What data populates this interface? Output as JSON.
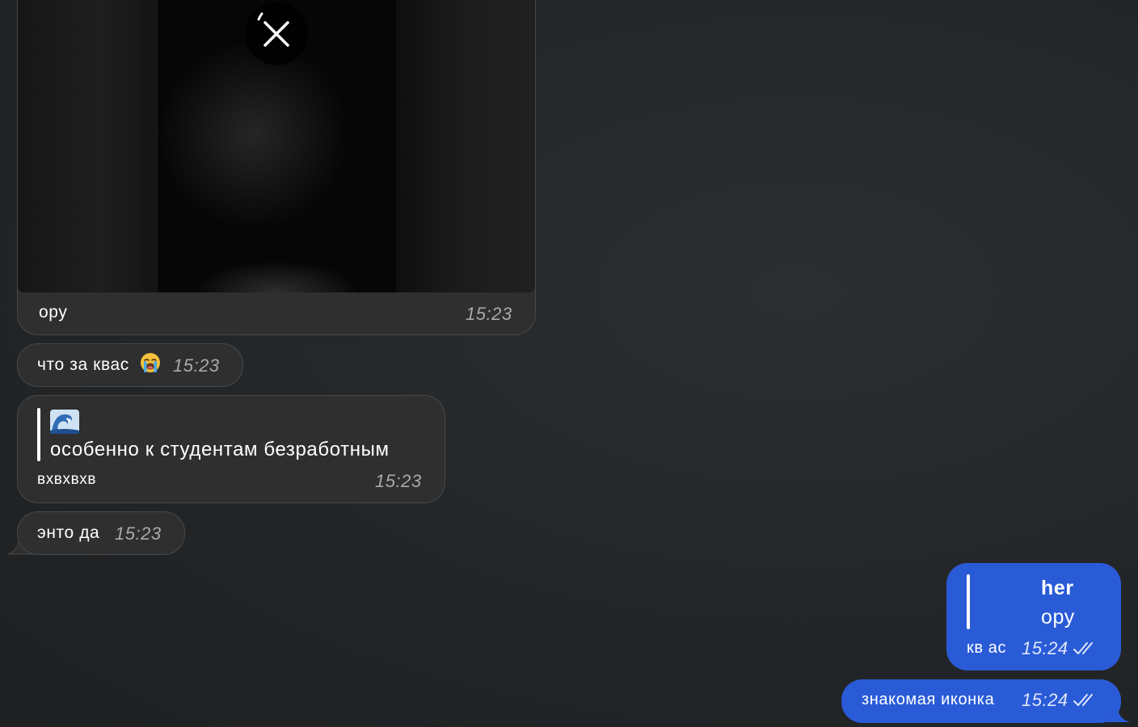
{
  "messages": {
    "media": {
      "caption": "ору",
      "time": "15:23",
      "cancel_icon": "close-icon"
    },
    "m1": {
      "text": "что за квас",
      "emoji": "loudly-crying-face-icon",
      "time": "15:23"
    },
    "m2": {
      "reply_emoji": "water-wave-icon",
      "reply_text": "особенно к студентам безработным",
      "text": "вхвхвхв",
      "time": "15:23"
    },
    "m3": {
      "text": "энто да",
      "time": "15:23"
    },
    "out1": {
      "reply_author": "her",
      "reply_text": "ору",
      "text": "кв ас",
      "time": "15:24",
      "status_icon": "double-check-icon"
    },
    "out2": {
      "text": "знакомая иконка",
      "time": "15:24",
      "status_icon": "double-check-icon"
    }
  },
  "colors": {
    "background": "#232628",
    "incoming_bubble": "#2f2f30",
    "outgoing_bubble": "#2a5bd7",
    "time_incoming": "#a8aaad"
  }
}
